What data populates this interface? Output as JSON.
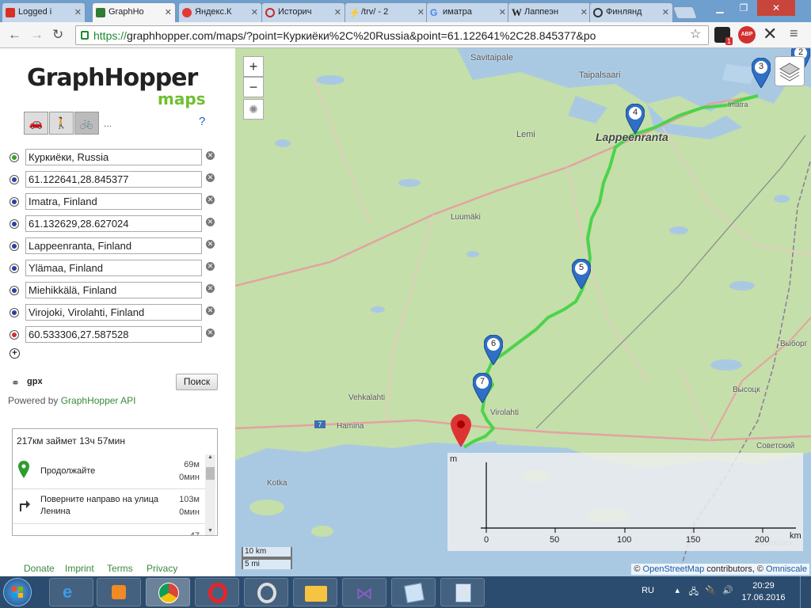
{
  "browser": {
    "tabs": [
      {
        "label": "Logged i",
        "icon": "gmail-icon",
        "color": "#d93025"
      },
      {
        "label": "GraphHo",
        "icon": "graphhopper-icon",
        "color": "#2e7d32",
        "active": true
      },
      {
        "label": "Яндекс.К",
        "icon": "yandex-maps-pin-icon",
        "color": "#e53935"
      },
      {
        "label": "Историч",
        "icon": "history-globe-icon",
        "color": "#c62828"
      },
      {
        "label": "/trv/ - 2",
        "icon": "lightning-icon",
        "color": "#ef6c00"
      },
      {
        "label": "иматра",
        "icon": "google-icon",
        "color": "#4285f4"
      },
      {
        "label": "Лаппеэн",
        "icon": "wikipedia-icon",
        "color": "#444444"
      },
      {
        "label": "Финлянд",
        "icon": "compass-icon",
        "color": "#333333"
      }
    ],
    "url_https": "https://",
    "url_rest": "graphhopper.com/maps/?point=Куркиёки%2C%20Russia&point=61.122641%2C28.845377&po",
    "extension_badge": "1",
    "extension_abp": "ABP"
  },
  "sidebar": {
    "logo_main": "GraphHopper",
    "logo_sub": "maps",
    "vehicles": [
      {
        "name": "car",
        "icon": "car-icon",
        "glyph": "🚗"
      },
      {
        "name": "foot",
        "icon": "walk-icon",
        "glyph": "🚶"
      },
      {
        "name": "bike",
        "icon": "bike-icon",
        "glyph": "🚲",
        "selected": true
      }
    ],
    "more_vehicles": "...",
    "help": "?",
    "waypoints": [
      {
        "value": "Куркиёки, Russia",
        "color": "#3aa02a"
      },
      {
        "value": "61.122641,28.845377",
        "color": "#2a3fa0"
      },
      {
        "value": "Imatra, Finland",
        "color": "#2a3fa0"
      },
      {
        "value": "61.132629,28.627024",
        "color": "#2a3fa0"
      },
      {
        "value": "Lappeenranta, Finland",
        "color": "#2a3fa0"
      },
      {
        "value": "Ylämaa, Finland",
        "color": "#2a3fa0"
      },
      {
        "value": "Miehikkälä, Finland",
        "color": "#2a3fa0"
      },
      {
        "value": "Virojoki, Virolahti, Finland",
        "color": "#2a3fa0"
      },
      {
        "value": "60.533306,27.587528",
        "color": "#d03030"
      }
    ],
    "add_point": "+",
    "gpx_label": "gpx",
    "search_button": "Поиск",
    "powered_by": "Powered by",
    "powered_link": "GraphHopper API",
    "summary": "217км займет 13ч 57мин",
    "steps": [
      {
        "text": "Продолжайте",
        "dist": "69м",
        "time": "0мин",
        "icon": "continue-pin-icon"
      },
      {
        "text": "Поверните направо на улица Ленина",
        "dist": "103м",
        "time": "0мин",
        "icon": "turn-right-icon"
      },
      {
        "text": "",
        "dist": "47",
        "time": "",
        "icon": ""
      }
    ],
    "footer": [
      "Donate",
      "Imprint",
      "Terms",
      "Privacy"
    ]
  },
  "map": {
    "zoom_in": "+",
    "zoom_out": "−",
    "place_labels": [
      {
        "name": "Savitaipale"
      },
      {
        "name": "Taipalsaari"
      },
      {
        "name": "Lemi"
      },
      {
        "name": "Lappeenranta"
      },
      {
        "name": "Luumäki"
      },
      {
        "name": "Vehkalahti"
      },
      {
        "name": "Hamina"
      },
      {
        "name": "Virolahti"
      },
      {
        "name": "Kotka"
      },
      {
        "name": "Выборг"
      },
      {
        "name": "Высоцк"
      },
      {
        "name": "Советский"
      },
      {
        "name": "Imatra"
      },
      {
        "name": "Приморск"
      }
    ],
    "road_shield": "7",
    "markers": [
      "3",
      "4",
      "5",
      "6",
      "7",
      "2"
    ],
    "elevation": {
      "y_unit": "m",
      "x_unit": "km",
      "x_ticks": [
        "0",
        "50",
        "100",
        "150",
        "200"
      ]
    },
    "scale_km": "10 km",
    "scale_mi": "5 mi",
    "attribution_prefix": "©",
    "attribution_osm": "OpenStreetMap",
    "attribution_mid": "contributors, ©",
    "attribution_omni": "Omniscale",
    "route_color": "#4cd34c"
  },
  "taskbar": {
    "lang": "RU",
    "time": "20:29",
    "date": "17.06.2016"
  }
}
